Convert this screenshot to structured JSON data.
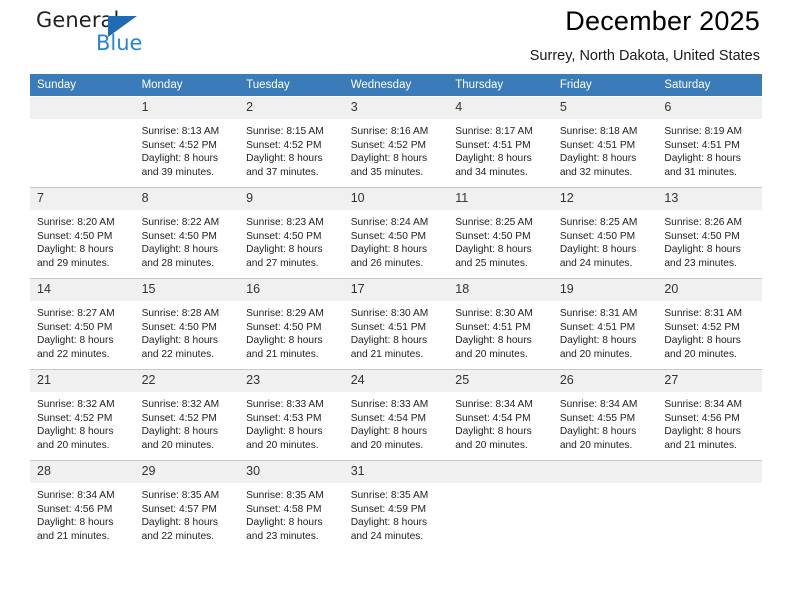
{
  "brand": {
    "name_part1": "General",
    "name_part2": "Blue",
    "triangle_color": "#1f6cb4",
    "blue_text_color": "#2a86d0"
  },
  "header": {
    "title": "December 2025",
    "subtitle": "Surrey, North Dakota, United States"
  },
  "theme": {
    "header_row_bg": "#3a7cba",
    "daynum_bg": "#f0f0f0",
    "grid_line": "#c8c8c8"
  },
  "weekday_headers": [
    "Sunday",
    "Monday",
    "Tuesday",
    "Wednesday",
    "Thursday",
    "Friday",
    "Saturday"
  ],
  "weeks": [
    [
      {
        "day": "",
        "lines": []
      },
      {
        "day": "1",
        "lines": [
          "Sunrise: 8:13 AM",
          "Sunset: 4:52 PM",
          "Daylight: 8 hours",
          "and 39 minutes."
        ]
      },
      {
        "day": "2",
        "lines": [
          "Sunrise: 8:15 AM",
          "Sunset: 4:52 PM",
          "Daylight: 8 hours",
          "and 37 minutes."
        ]
      },
      {
        "day": "3",
        "lines": [
          "Sunrise: 8:16 AM",
          "Sunset: 4:52 PM",
          "Daylight: 8 hours",
          "and 35 minutes."
        ]
      },
      {
        "day": "4",
        "lines": [
          "Sunrise: 8:17 AM",
          "Sunset: 4:51 PM",
          "Daylight: 8 hours",
          "and 34 minutes."
        ]
      },
      {
        "day": "5",
        "lines": [
          "Sunrise: 8:18 AM",
          "Sunset: 4:51 PM",
          "Daylight: 8 hours",
          "and 32 minutes."
        ]
      },
      {
        "day": "6",
        "lines": [
          "Sunrise: 8:19 AM",
          "Sunset: 4:51 PM",
          "Daylight: 8 hours",
          "and 31 minutes."
        ]
      }
    ],
    [
      {
        "day": "7",
        "lines": [
          "Sunrise: 8:20 AM",
          "Sunset: 4:50 PM",
          "Daylight: 8 hours",
          "and 29 minutes."
        ]
      },
      {
        "day": "8",
        "lines": [
          "Sunrise: 8:22 AM",
          "Sunset: 4:50 PM",
          "Daylight: 8 hours",
          "and 28 minutes."
        ]
      },
      {
        "day": "9",
        "lines": [
          "Sunrise: 8:23 AM",
          "Sunset: 4:50 PM",
          "Daylight: 8 hours",
          "and 27 minutes."
        ]
      },
      {
        "day": "10",
        "lines": [
          "Sunrise: 8:24 AM",
          "Sunset: 4:50 PM",
          "Daylight: 8 hours",
          "and 26 minutes."
        ]
      },
      {
        "day": "11",
        "lines": [
          "Sunrise: 8:25 AM",
          "Sunset: 4:50 PM",
          "Daylight: 8 hours",
          "and 25 minutes."
        ]
      },
      {
        "day": "12",
        "lines": [
          "Sunrise: 8:25 AM",
          "Sunset: 4:50 PM",
          "Daylight: 8 hours",
          "and 24 minutes."
        ]
      },
      {
        "day": "13",
        "lines": [
          "Sunrise: 8:26 AM",
          "Sunset: 4:50 PM",
          "Daylight: 8 hours",
          "and 23 minutes."
        ]
      }
    ],
    [
      {
        "day": "14",
        "lines": [
          "Sunrise: 8:27 AM",
          "Sunset: 4:50 PM",
          "Daylight: 8 hours",
          "and 22 minutes."
        ]
      },
      {
        "day": "15",
        "lines": [
          "Sunrise: 8:28 AM",
          "Sunset: 4:50 PM",
          "Daylight: 8 hours",
          "and 22 minutes."
        ]
      },
      {
        "day": "16",
        "lines": [
          "Sunrise: 8:29 AM",
          "Sunset: 4:50 PM",
          "Daylight: 8 hours",
          "and 21 minutes."
        ]
      },
      {
        "day": "17",
        "lines": [
          "Sunrise: 8:30 AM",
          "Sunset: 4:51 PM",
          "Daylight: 8 hours",
          "and 21 minutes."
        ]
      },
      {
        "day": "18",
        "lines": [
          "Sunrise: 8:30 AM",
          "Sunset: 4:51 PM",
          "Daylight: 8 hours",
          "and 20 minutes."
        ]
      },
      {
        "day": "19",
        "lines": [
          "Sunrise: 8:31 AM",
          "Sunset: 4:51 PM",
          "Daylight: 8 hours",
          "and 20 minutes."
        ]
      },
      {
        "day": "20",
        "lines": [
          "Sunrise: 8:31 AM",
          "Sunset: 4:52 PM",
          "Daylight: 8 hours",
          "and 20 minutes."
        ]
      }
    ],
    [
      {
        "day": "21",
        "lines": [
          "Sunrise: 8:32 AM",
          "Sunset: 4:52 PM",
          "Daylight: 8 hours",
          "and 20 minutes."
        ]
      },
      {
        "day": "22",
        "lines": [
          "Sunrise: 8:32 AM",
          "Sunset: 4:52 PM",
          "Daylight: 8 hours",
          "and 20 minutes."
        ]
      },
      {
        "day": "23",
        "lines": [
          "Sunrise: 8:33 AM",
          "Sunset: 4:53 PM",
          "Daylight: 8 hours",
          "and 20 minutes."
        ]
      },
      {
        "day": "24",
        "lines": [
          "Sunrise: 8:33 AM",
          "Sunset: 4:54 PM",
          "Daylight: 8 hours",
          "and 20 minutes."
        ]
      },
      {
        "day": "25",
        "lines": [
          "Sunrise: 8:34 AM",
          "Sunset: 4:54 PM",
          "Daylight: 8 hours",
          "and 20 minutes."
        ]
      },
      {
        "day": "26",
        "lines": [
          "Sunrise: 8:34 AM",
          "Sunset: 4:55 PM",
          "Daylight: 8 hours",
          "and 20 minutes."
        ]
      },
      {
        "day": "27",
        "lines": [
          "Sunrise: 8:34 AM",
          "Sunset: 4:56 PM",
          "Daylight: 8 hours",
          "and 21 minutes."
        ]
      }
    ],
    [
      {
        "day": "28",
        "lines": [
          "Sunrise: 8:34 AM",
          "Sunset: 4:56 PM",
          "Daylight: 8 hours",
          "and 21 minutes."
        ]
      },
      {
        "day": "29",
        "lines": [
          "Sunrise: 8:35 AM",
          "Sunset: 4:57 PM",
          "Daylight: 8 hours",
          "and 22 minutes."
        ]
      },
      {
        "day": "30",
        "lines": [
          "Sunrise: 8:35 AM",
          "Sunset: 4:58 PM",
          "Daylight: 8 hours",
          "and 23 minutes."
        ]
      },
      {
        "day": "31",
        "lines": [
          "Sunrise: 8:35 AM",
          "Sunset: 4:59 PM",
          "Daylight: 8 hours",
          "and 24 minutes."
        ]
      },
      {
        "day": "",
        "lines": []
      },
      {
        "day": "",
        "lines": []
      },
      {
        "day": "",
        "lines": []
      }
    ]
  ]
}
